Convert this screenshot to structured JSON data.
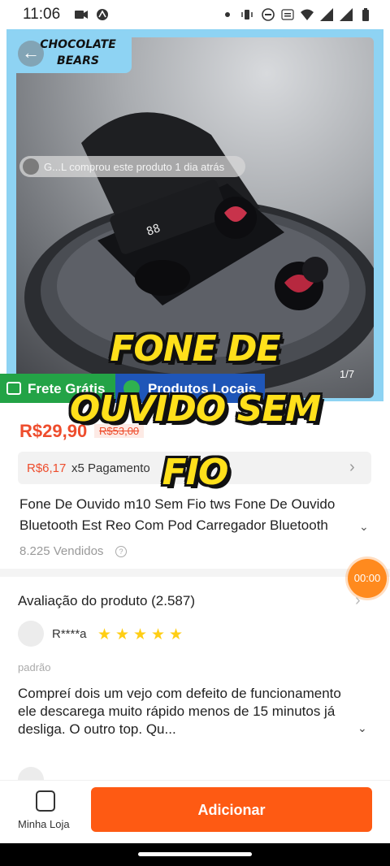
{
  "status_bar": {
    "time": "11:06"
  },
  "media": {
    "brand_text": "CHOCOLATE BEARS",
    "recent_purchase": "G...L comprou este produto 1 dia atrás",
    "counter": "1/7",
    "frete_badge": "Frete Grátis",
    "locais_badge": "Produtos Locais"
  },
  "overlay_caption": {
    "line1": "FONE DE",
    "line2": "OUVIDO SEM",
    "line3": "FIO"
  },
  "price": {
    "current": "R$29,90",
    "original": "R$53,00"
  },
  "installment": {
    "amount": "R$6,17",
    "text": "x5 Pagamento"
  },
  "product": {
    "title_line1": "Fone De Ouvido m10 Sem Fio tws Fone De Ouvido",
    "title_line2": "Bluetooth Est Reo Com Pod Carregador Bluetooth",
    "sold": "8.225 Vendidos"
  },
  "timer": "00:00",
  "reviews": {
    "title": "Avaliação do produto (2.587)",
    "items": [
      {
        "reviewer": "R****a",
        "rating": 5,
        "variant": "padrão",
        "body": "Compreí dois um vejo com defeito de funcionamento  ele descarega muito rápido menos de 15 minutos já desliga. O outro top. Qu..."
      }
    ]
  },
  "bottom_bar": {
    "store_label": "Minha Loja",
    "add_button": "Adicionar"
  },
  "colors": {
    "accent": "#fe5a13",
    "price": "#ee4d2d",
    "frete": "#23a346",
    "locais": "#1f56b8",
    "caption": "#ffe01b"
  }
}
